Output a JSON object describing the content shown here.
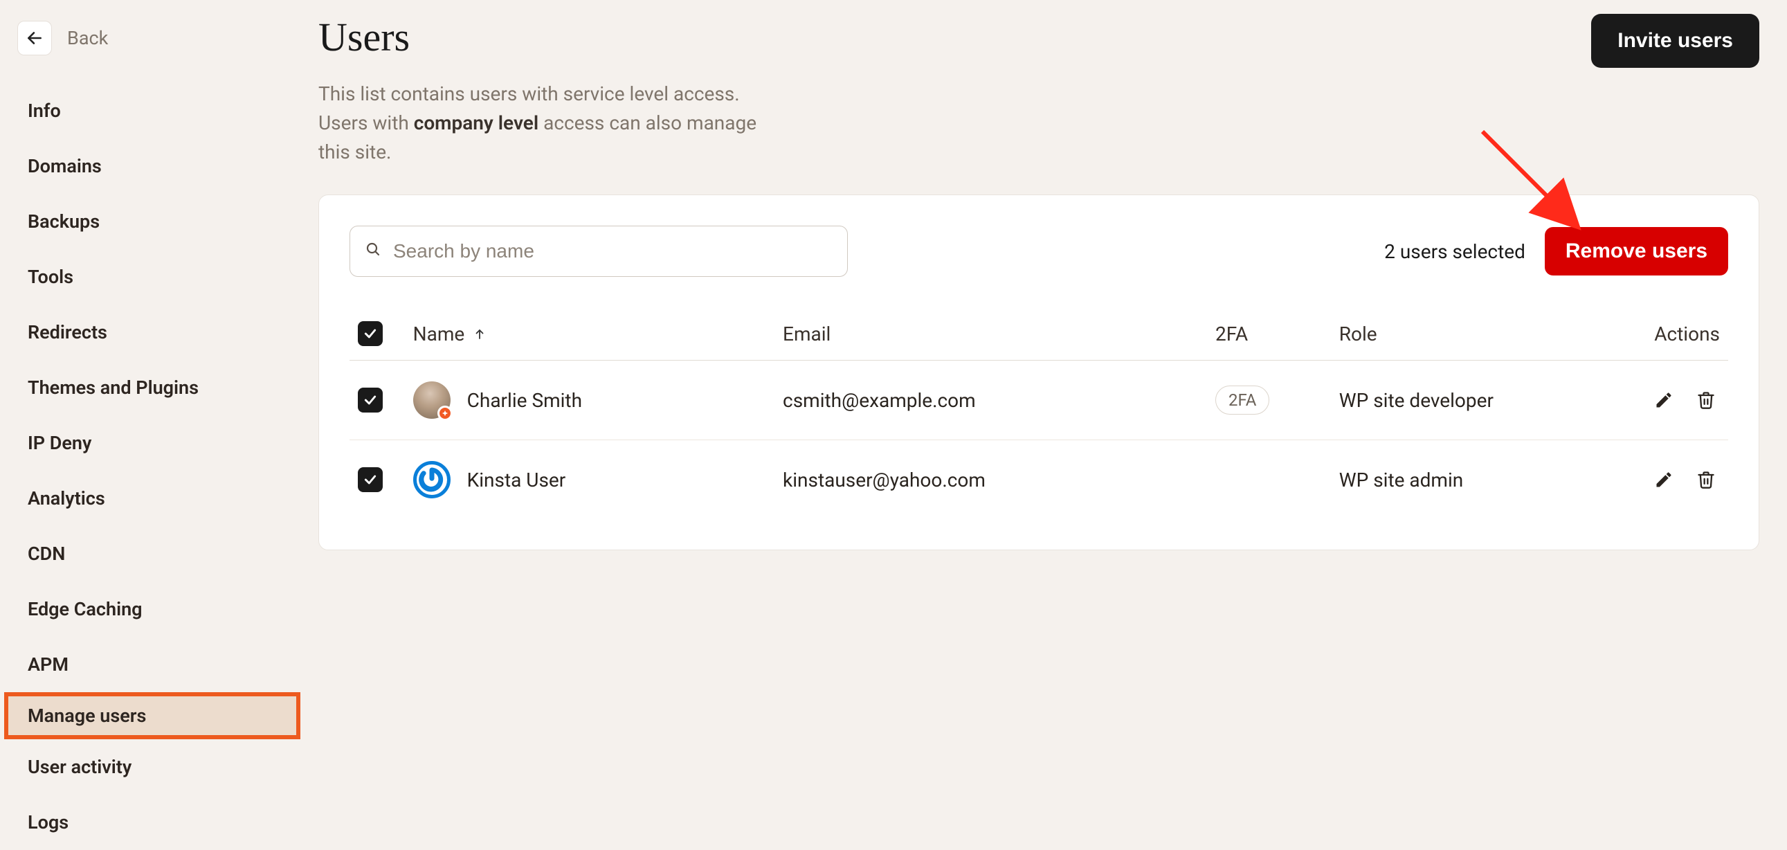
{
  "back": {
    "label": "Back"
  },
  "sidebar": {
    "items": [
      {
        "label": "Info"
      },
      {
        "label": "Domains"
      },
      {
        "label": "Backups"
      },
      {
        "label": "Tools"
      },
      {
        "label": "Redirects"
      },
      {
        "label": "Themes and Plugins"
      },
      {
        "label": "IP Deny"
      },
      {
        "label": "Analytics"
      },
      {
        "label": "CDN"
      },
      {
        "label": "Edge Caching"
      },
      {
        "label": "APM"
      },
      {
        "label": "Manage users"
      },
      {
        "label": "User activity"
      },
      {
        "label": "Logs"
      }
    ],
    "active_index": 11
  },
  "header": {
    "title": "Users",
    "description_pre": "This list contains users with service level access. Users with ",
    "description_bold": "company level",
    "description_post": " access can also manage this site.",
    "invite_label": "Invite users"
  },
  "toolbar": {
    "search_placeholder": "Search by name",
    "search_value": "",
    "selected_text": "2 users selected",
    "remove_label": "Remove users"
  },
  "table": {
    "columns": {
      "name": "Name",
      "email": "Email",
      "twofa": "2FA",
      "role": "Role",
      "actions": "Actions"
    },
    "rows": [
      {
        "checked": true,
        "avatar": "photo",
        "avatar_badge": true,
        "name": "Charlie Smith",
        "email": "csmith@example.com",
        "twofa": "2FA",
        "role": "WP site developer"
      },
      {
        "checked": true,
        "avatar": "icon",
        "avatar_badge": false,
        "name": "Kinsta User",
        "email": "kinstauser@yahoo.com",
        "twofa": "",
        "role": "WP site admin"
      }
    ]
  },
  "colors": {
    "background": "#f5f1ed",
    "accent_highlight": "#ed5a1e",
    "danger": "#d70000",
    "primary": "#1a1a1a"
  }
}
